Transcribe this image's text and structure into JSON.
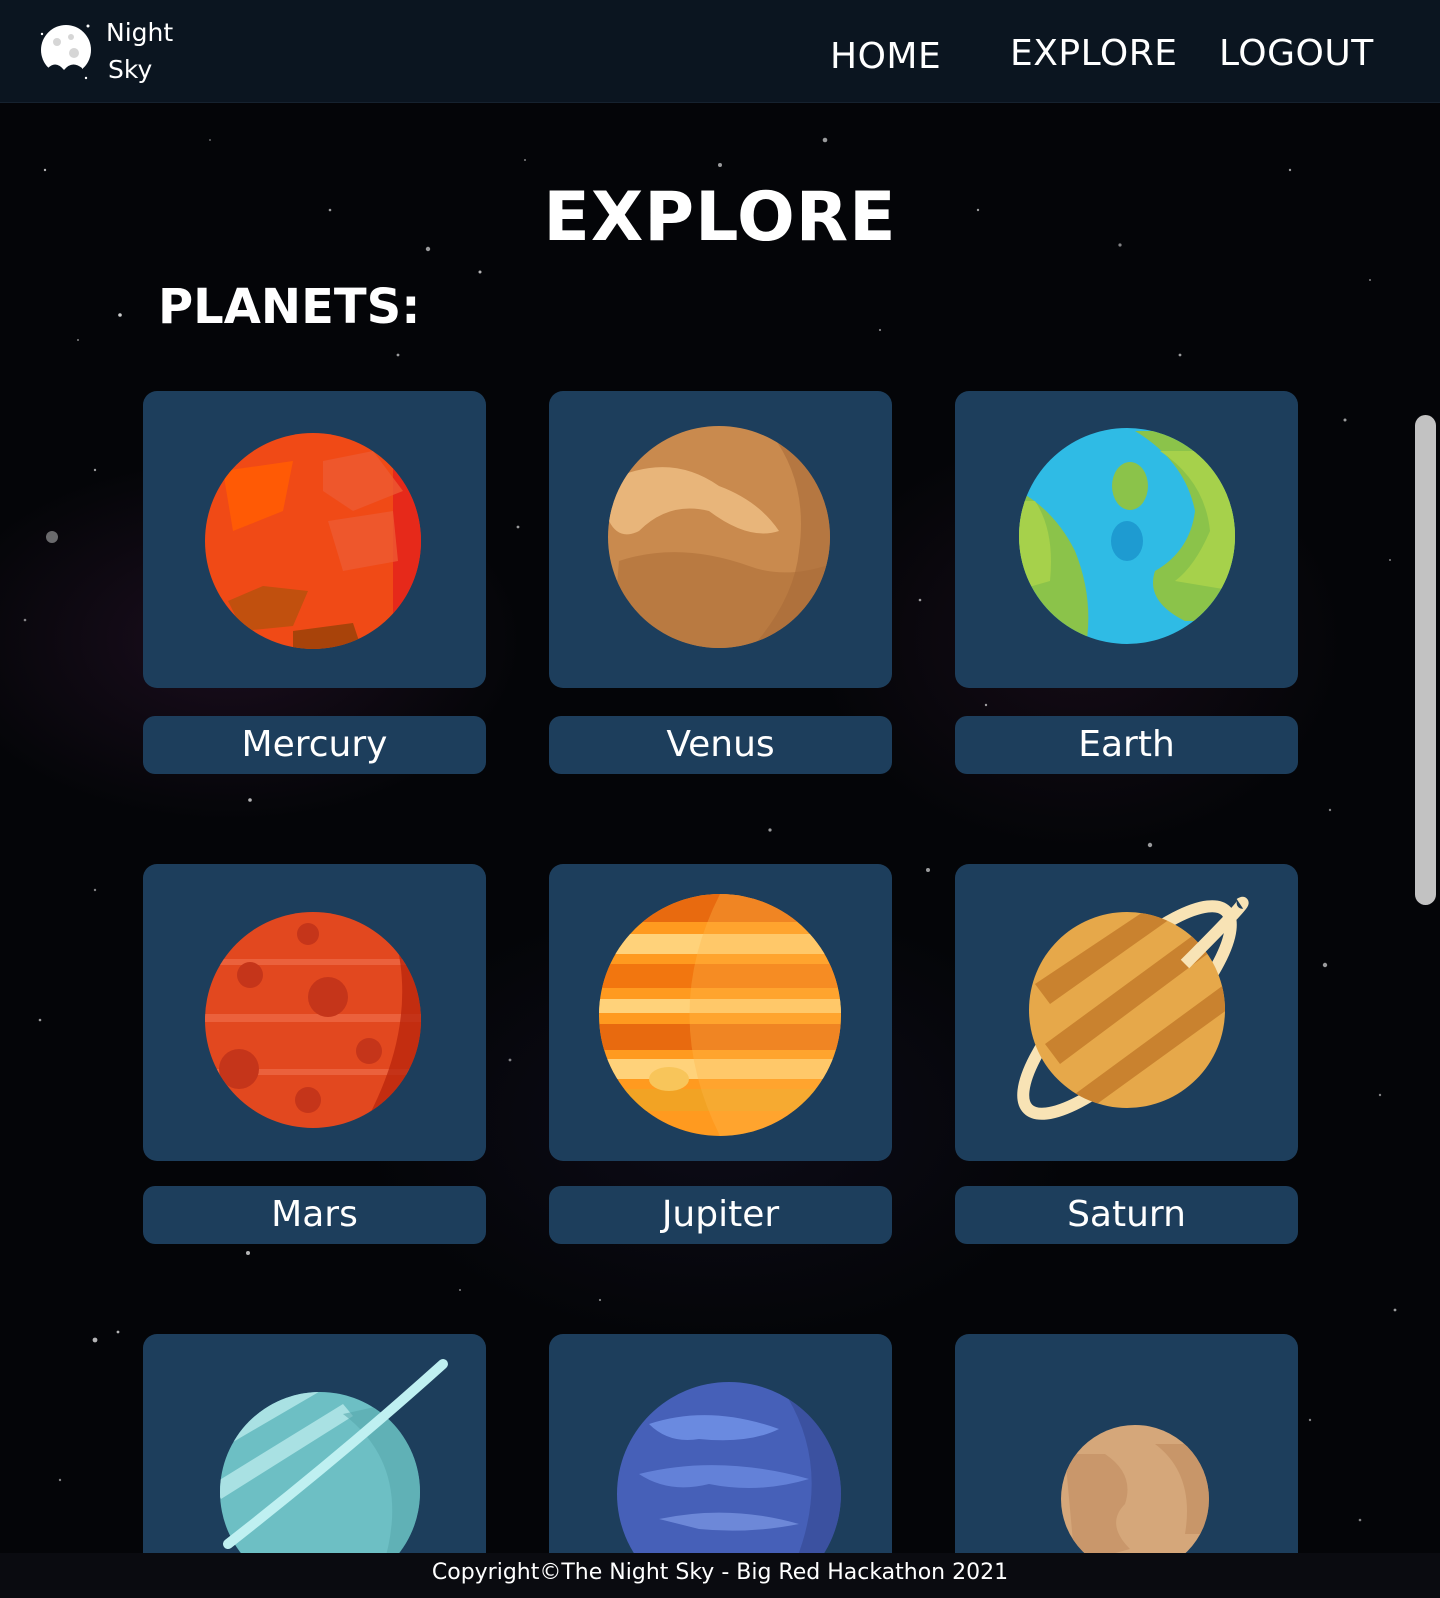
{
  "brand": {
    "line1": "Night",
    "line2": "Sky",
    "logo_icon": "moon-logo-icon"
  },
  "nav": {
    "home": "HOME",
    "explore": "EXPLORE",
    "logout": "LOGOUT"
  },
  "page": {
    "title": "EXPLORE",
    "section": "PLANETS:"
  },
  "planets": [
    {
      "name": "Mercury",
      "icon": "mercury-planet-icon"
    },
    {
      "name": "Venus",
      "icon": "venus-planet-icon"
    },
    {
      "name": "Earth",
      "icon": "earth-planet-icon"
    },
    {
      "name": "Mars",
      "icon": "mars-planet-icon"
    },
    {
      "name": "Jupiter",
      "icon": "jupiter-planet-icon"
    },
    {
      "name": "Saturn",
      "icon": "saturn-planet-icon"
    },
    {
      "name": "",
      "icon": "uranus-planet-icon"
    },
    {
      "name": "",
      "icon": "neptune-planet-icon"
    },
    {
      "name": "",
      "icon": "pluto-planet-icon"
    }
  ],
  "footer": {
    "copyright": "Copyright©The Night Sky - Big Red Hackathon 2021"
  },
  "colors": {
    "card": "#1d3e5c",
    "header": "#0b1520",
    "background": "#040508"
  }
}
